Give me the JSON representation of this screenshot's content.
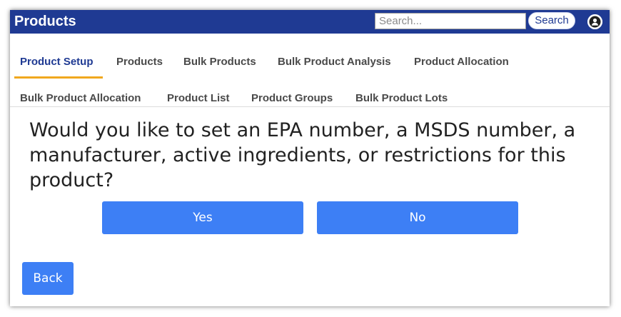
{
  "header": {
    "title": "Products",
    "search_placeholder": "Search...",
    "search_button_label": "Search",
    "avatar_icon": "user-icon",
    "bar_color": "#1f3a93"
  },
  "tabs": [
    {
      "label": "Product Setup",
      "active": true
    },
    {
      "label": "Products",
      "active": false
    },
    {
      "label": "Bulk Products",
      "active": false
    },
    {
      "label": "Bulk Product Analysis",
      "active": false
    },
    {
      "label": "Product Allocation",
      "active": false
    },
    {
      "label": "Bulk Product Allocation",
      "active": false
    },
    {
      "label": "Product List",
      "active": false
    },
    {
      "label": "Product Groups",
      "active": false
    },
    {
      "label": "Bulk Product Lots",
      "active": false
    }
  ],
  "active_tab_underline_color": "#f0a81e",
  "main": {
    "question": "Would you like to set an EPA number, a MSDS number, a manufacturer, active ingredients, or restrictions for this product?",
    "yes_label": "Yes",
    "no_label": "No",
    "back_label": "Back",
    "button_color": "#3d7ff5"
  }
}
